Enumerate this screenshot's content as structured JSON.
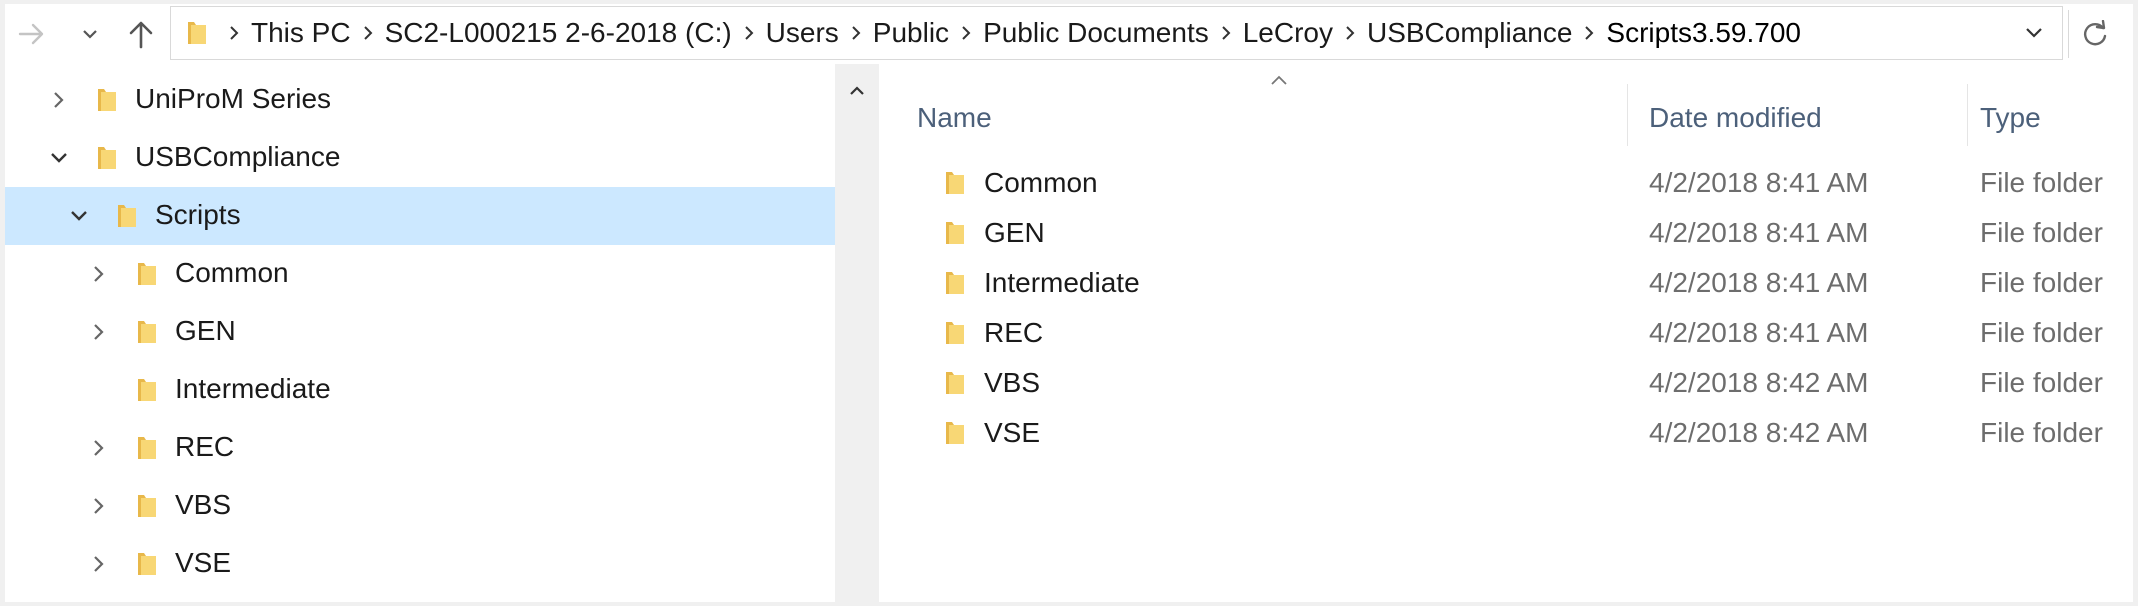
{
  "colors": {
    "selection": "#cce8ff",
    "folder_yellow": "#f8d775",
    "folder_dark": "#e8b84a",
    "header_text": "#4c607a",
    "secondary_text": "#6d6d6d"
  },
  "nav": {
    "forward_icon": "arrow-right-icon",
    "recent_icon": "chevron-down-icon",
    "up_icon": "arrow-up-icon",
    "refresh_icon": "refresh-icon"
  },
  "address": {
    "crumbs": [
      "This PC",
      "SC2-L000215 2-6-2018 (C:)",
      "Users",
      "Public",
      "Public Documents",
      "LeCroy",
      "USBCompliance"
    ],
    "edit_text": "Scripts3.59.700"
  },
  "tree": {
    "items": [
      {
        "label": "UniProM Series",
        "expander": "collapsed"
      },
      {
        "label": "USBCompliance",
        "expander": "expanded"
      },
      {
        "label": "Scripts",
        "expander": "expanded",
        "selected": true
      },
      {
        "label": "Common",
        "expander": "collapsed"
      },
      {
        "label": "GEN",
        "expander": "collapsed"
      },
      {
        "label": "Intermediate",
        "expander": "none"
      },
      {
        "label": "REC",
        "expander": "collapsed"
      },
      {
        "label": "VBS",
        "expander": "collapsed"
      },
      {
        "label": "VSE",
        "expander": "collapsed"
      }
    ]
  },
  "list": {
    "columns": {
      "name": "Name",
      "date": "Date modified",
      "type": "Type"
    },
    "sort": "name-ascending",
    "rows": [
      {
        "name": "Common",
        "date": "4/2/2018 8:41 AM",
        "type": "File folder"
      },
      {
        "name": "GEN",
        "date": "4/2/2018 8:41 AM",
        "type": "File folder"
      },
      {
        "name": "Intermediate",
        "date": "4/2/2018 8:41 AM",
        "type": "File folder"
      },
      {
        "name": "REC",
        "date": "4/2/2018 8:41 AM",
        "type": "File folder"
      },
      {
        "name": "VBS",
        "date": "4/2/2018 8:42 AM",
        "type": "File folder"
      },
      {
        "name": "VSE",
        "date": "4/2/2018 8:42 AM",
        "type": "File folder"
      }
    ]
  }
}
